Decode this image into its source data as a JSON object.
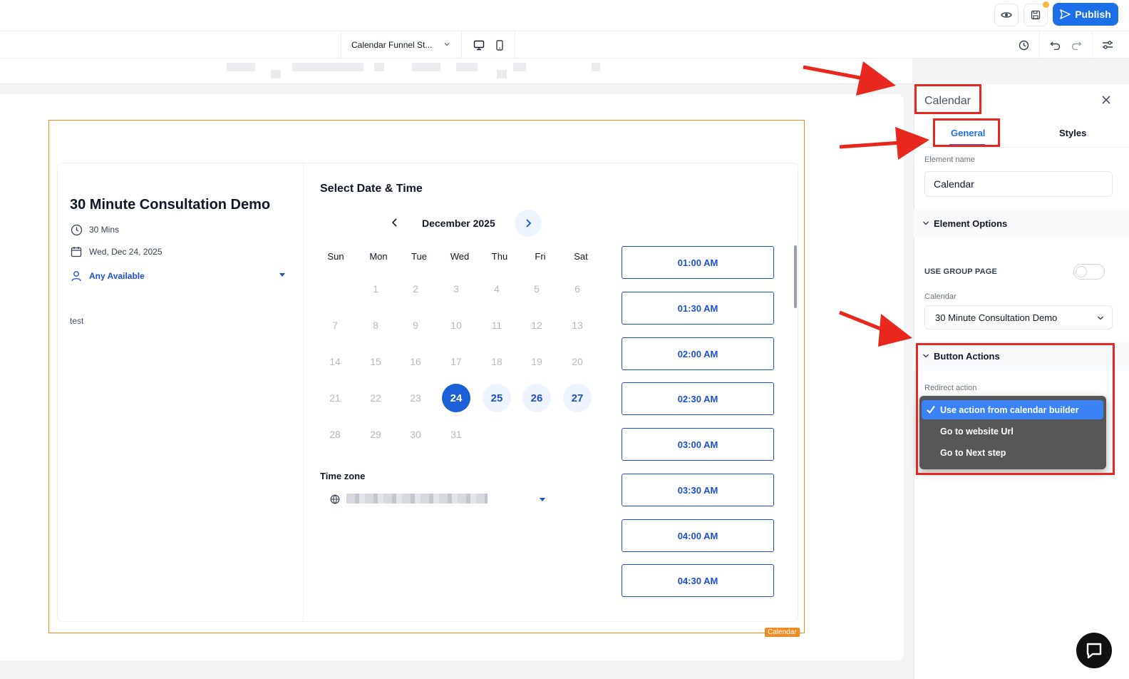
{
  "topbar": {
    "publish_label": "Publish",
    "preview_icon": "eye-icon",
    "save_icon": "save-icon"
  },
  "subbar": {
    "page_name": "Calendar Funnel St...",
    "desktop_icon": "desktop-icon",
    "mobile_icon": "mobile-icon",
    "history_icon": "history-icon",
    "undo_icon": "undo-icon",
    "redo_icon": "redo-icon",
    "settings_icon": "settings-sliders-icon"
  },
  "widget": {
    "event_title": "30 Minute Consultation Demo",
    "duration": "30 Mins",
    "date": "Wed, Dec 24, 2025",
    "host": "Any Available",
    "description": "test",
    "select_title": "Select Date & Time",
    "month": "December 2025",
    "weekdays": [
      "Sun",
      "Mon",
      "Tue",
      "Wed",
      "Thu",
      "Fri",
      "Sat"
    ],
    "days": [
      [
        "",
        "1",
        "2",
        "3",
        "4",
        "5",
        "6"
      ],
      [
        "7",
        "8",
        "9",
        "10",
        "11",
        "12",
        "13"
      ],
      [
        "14",
        "15",
        "16",
        "17",
        "18",
        "19",
        "20"
      ],
      [
        "21",
        "22",
        "23",
        "24",
        "25",
        "26",
        "27"
      ],
      [
        "28",
        "29",
        "30",
        "31",
        "",
        "",
        ""
      ]
    ],
    "selected_day": "24",
    "available_days": [
      "25",
      "26",
      "27"
    ],
    "timezone_label": "Time zone",
    "slots": [
      "01:00 AM",
      "01:30 AM",
      "02:00 AM",
      "02:30 AM",
      "03:00 AM",
      "03:30 AM",
      "04:00 AM",
      "04:30 AM"
    ],
    "frame_tag": "Calendar"
  },
  "panel": {
    "title": "Calendar",
    "tabs": [
      "General",
      "Styles"
    ],
    "element_name_label": "Element name",
    "element_name_value": "Calendar",
    "element_options_label": "Element Options",
    "use_group_page_label": "USE GROUP PAGE",
    "calendar_label": "Calendar",
    "calendar_value": "30 Minute Consultation Demo",
    "button_actions_label": "Button Actions",
    "redirect_label": "Redirect action",
    "redirect_options": [
      "Use action from calendar builder",
      "Go to website Url",
      "Go to Next step"
    ]
  },
  "colors": {
    "primary": "#1d6fe8",
    "highlight": "#e8281e",
    "frame": "#f08a24"
  }
}
